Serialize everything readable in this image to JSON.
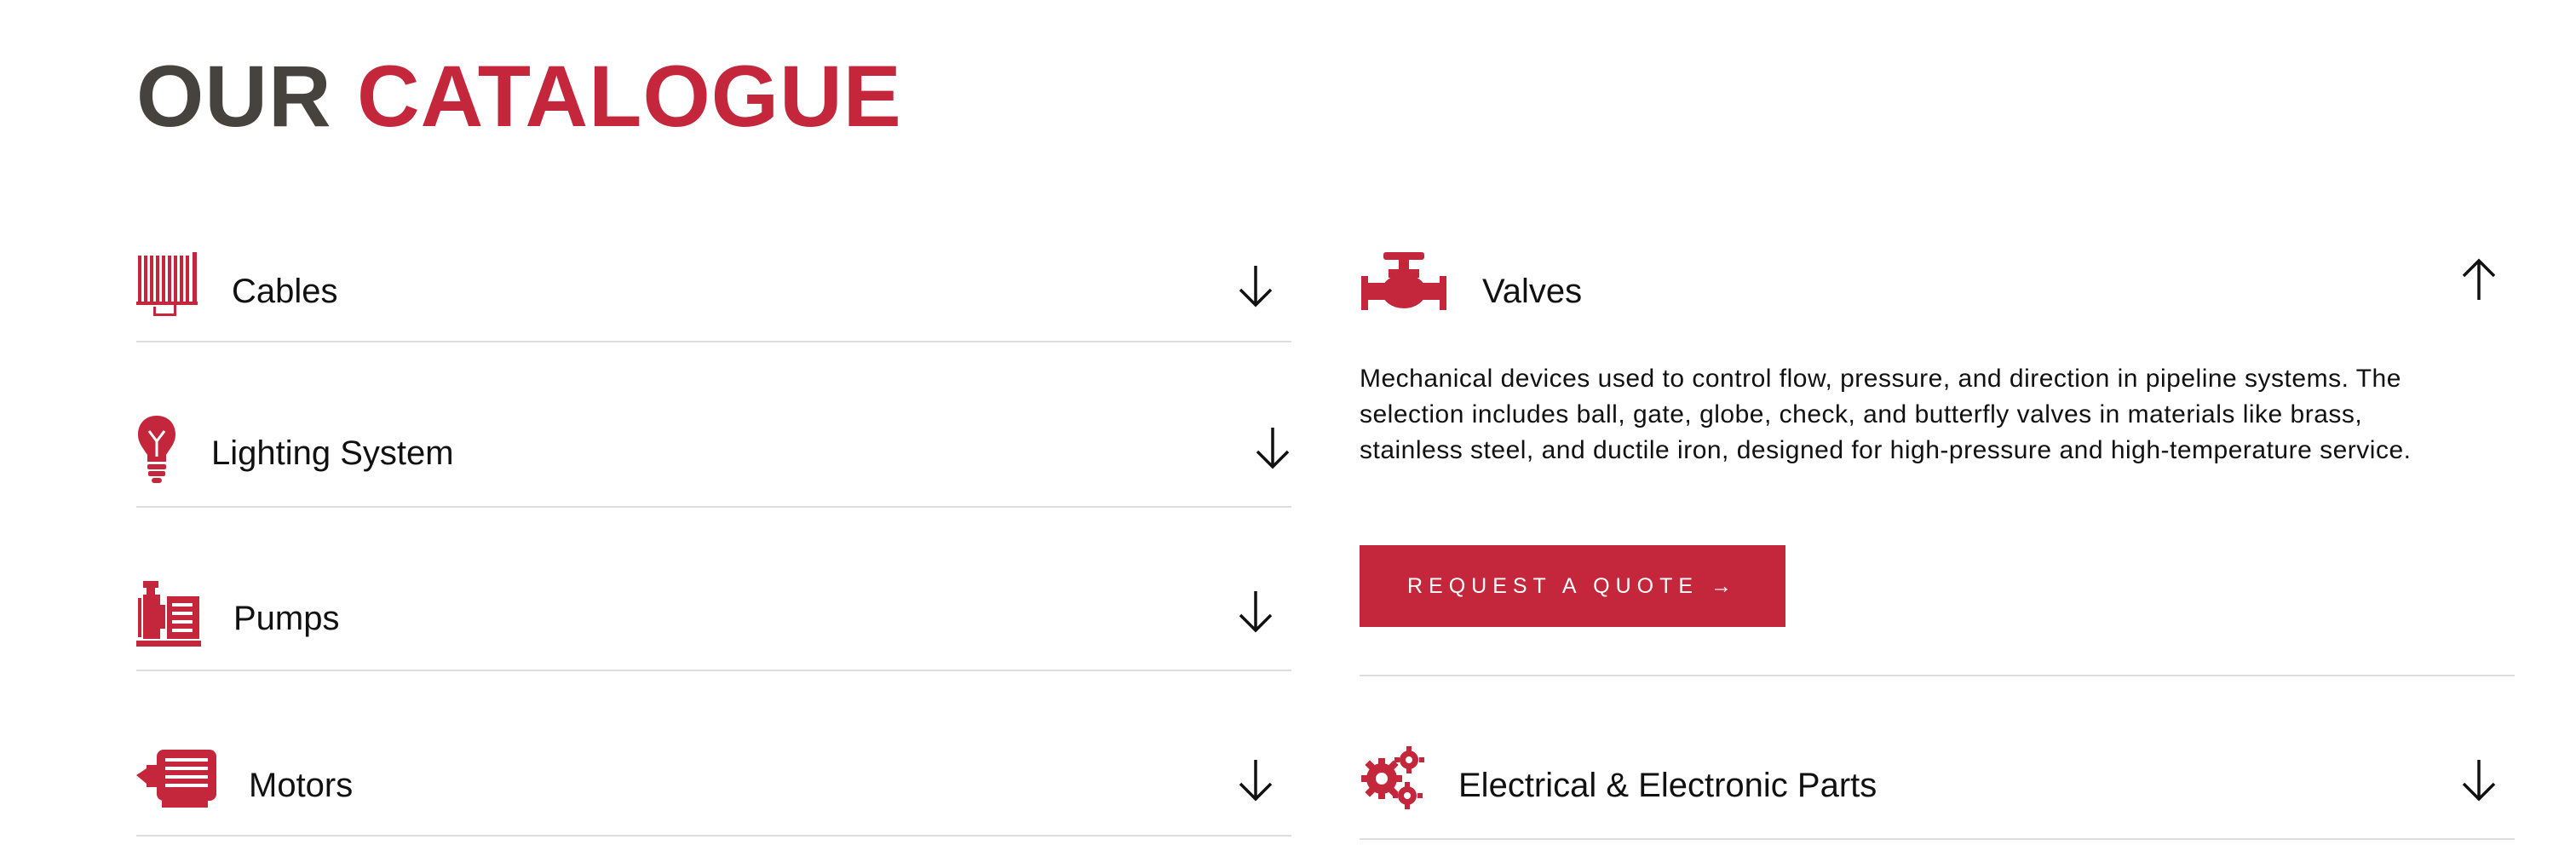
{
  "heading": {
    "part1": "OUR",
    "part2": "CATALOGUE"
  },
  "colors": {
    "accent": "#c4273b",
    "heading_dark": "#46423e",
    "divider": "#dddddd"
  },
  "left_items": [
    {
      "label": "Cables",
      "icon": "cable-reel-icon",
      "state": "collapsed"
    },
    {
      "label": "Lighting System",
      "icon": "light-bulb-icon",
      "state": "collapsed"
    },
    {
      "label": "Pumps",
      "icon": "pump-icon",
      "state": "collapsed"
    },
    {
      "label": "Motors",
      "icon": "motor-icon",
      "state": "collapsed"
    }
  ],
  "right_items": [
    {
      "label": "Valves",
      "icon": "valve-icon",
      "state": "expanded",
      "description": "Mechanical devices used to control flow, pressure, and direction in pipeline systems. The selection includes ball, gate, globe, check, and butterfly valves in materials like brass, stainless steel, and ductile iron, designed for high-pressure and high-temperature service.",
      "button_label": "REQUEST A QUOTE →"
    },
    {
      "label": "Electrical & Electronic Parts",
      "icon": "gears-icon",
      "state": "collapsed"
    }
  ]
}
